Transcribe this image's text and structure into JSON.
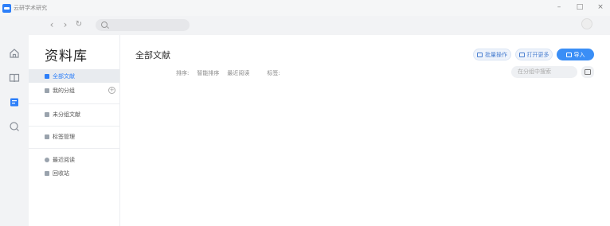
{
  "titlebar": {
    "app_title": "云研学术研究"
  },
  "library": {
    "title": "资料库",
    "items": [
      {
        "label": "全部文献",
        "active": true
      },
      {
        "label": "我的分组"
      },
      {
        "label": "未分组文献"
      },
      {
        "label": "标签管理"
      },
      {
        "label": "最近阅读"
      },
      {
        "label": "回收站"
      }
    ]
  },
  "main": {
    "title": "全部文献",
    "sort_label": "排序:",
    "sort_options": [
      "智能排序",
      "最近阅读"
    ],
    "filter_label": "标签:",
    "buttons": {
      "batch": "批量操作",
      "open_more": "打开更多",
      "import": "导入"
    },
    "search_placeholder": "在分组中搜索"
  },
  "colors": {
    "accent": "#2d7ff9",
    "import_button": "#3a8ef6"
  },
  "icons": [
    "back-icon",
    "forward-icon",
    "refresh-icon",
    "search-icon",
    "home-icon",
    "book-icon",
    "library-icon",
    "discover-icon",
    "calendar-icon"
  ]
}
